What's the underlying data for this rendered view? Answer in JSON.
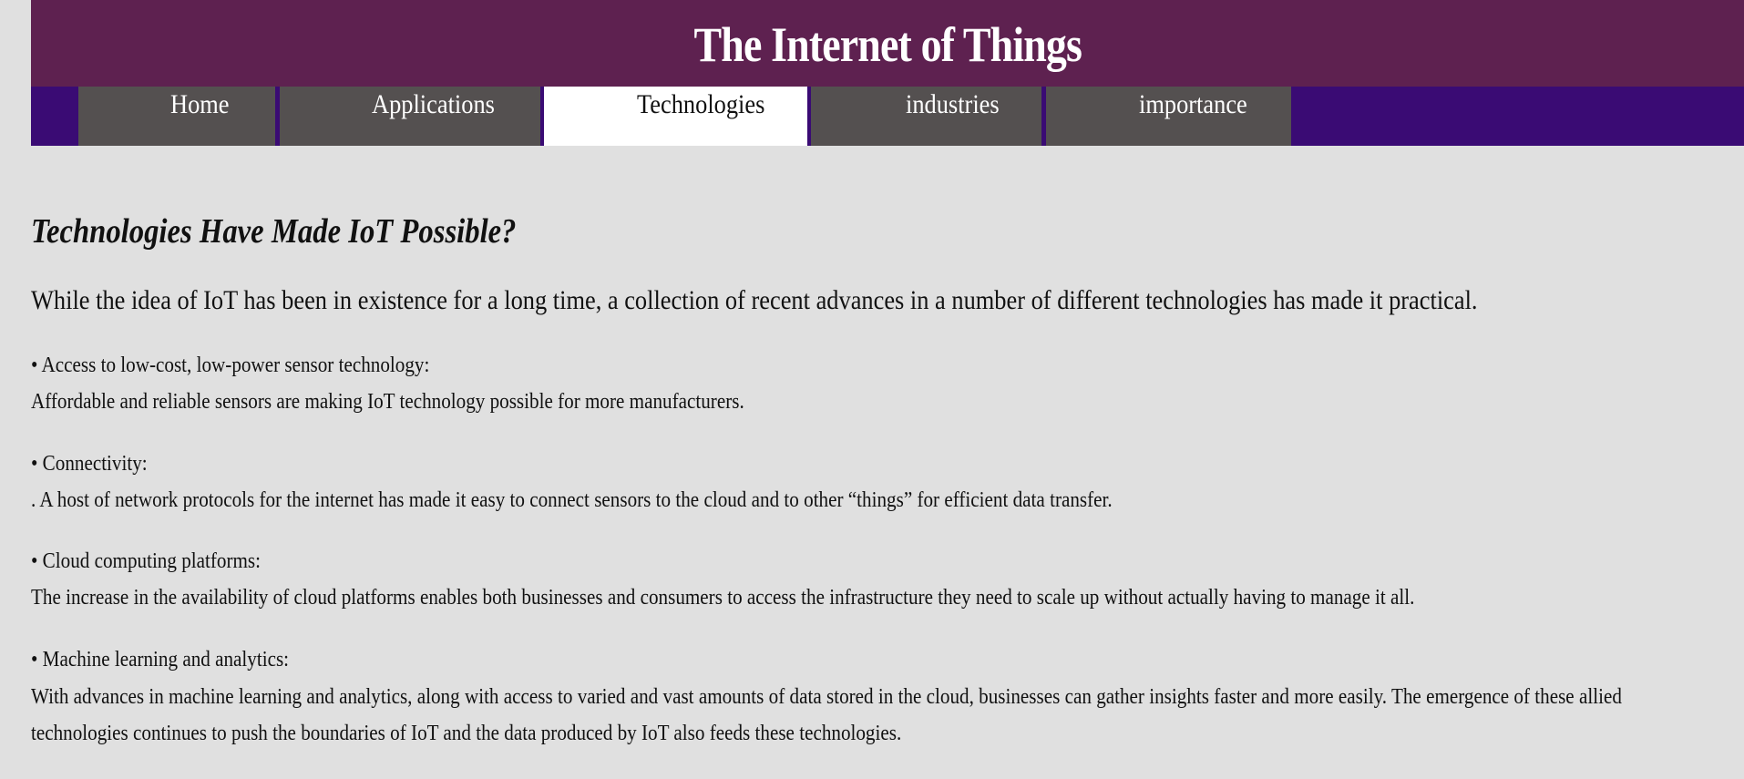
{
  "header": {
    "title": "The Internet of Things"
  },
  "nav": {
    "items": [
      {
        "label": "Home"
      },
      {
        "label": "Applications"
      },
      {
        "label": "Technologies"
      },
      {
        "label": "industries"
      },
      {
        "label": "importance"
      }
    ],
    "active": "Technologies"
  },
  "main": {
    "title": "Technologies Have Made IoT Possible?",
    "intro": "While the idea of IoT has been in existence for a long time, a collection of recent advances in a number of different technologies has made it practical.",
    "sections": [
      {
        "heading": "• Access to low-cost, low-power sensor technology:",
        "body": [
          "Affordable and reliable sensors are making IoT technology possible for more manufacturers."
        ]
      },
      {
        "heading": "• Connectivity:",
        "body": [
          ". A host of network protocols for the internet has made it easy to connect sensors to the cloud and to other “things” for efficient data transfer."
        ]
      },
      {
        "heading": "• Cloud computing platforms:",
        "body": [
          "The increase in the availability of cloud platforms enables both businesses and consumers to access the infrastructure they need to scale up without actually having to manage it all."
        ]
      },
      {
        "heading": "• Machine learning and analytics:",
        "body": [
          "With advances in machine learning and analytics, along with access to varied and vast amounts of data stored in the cloud, businesses can gather insights faster and more easily. The emergence of these allied",
          "technologies continues to push the boundaries of IoT and the data produced by IoT also feeds these technologies."
        ]
      }
    ]
  },
  "colors": {
    "header_bg": "#5e2150",
    "nav_bg": "#3a0b74",
    "nav_item_bg": "#545050",
    "nav_active_bg": "#ffffff",
    "page_bg": "#e0e0e0"
  }
}
